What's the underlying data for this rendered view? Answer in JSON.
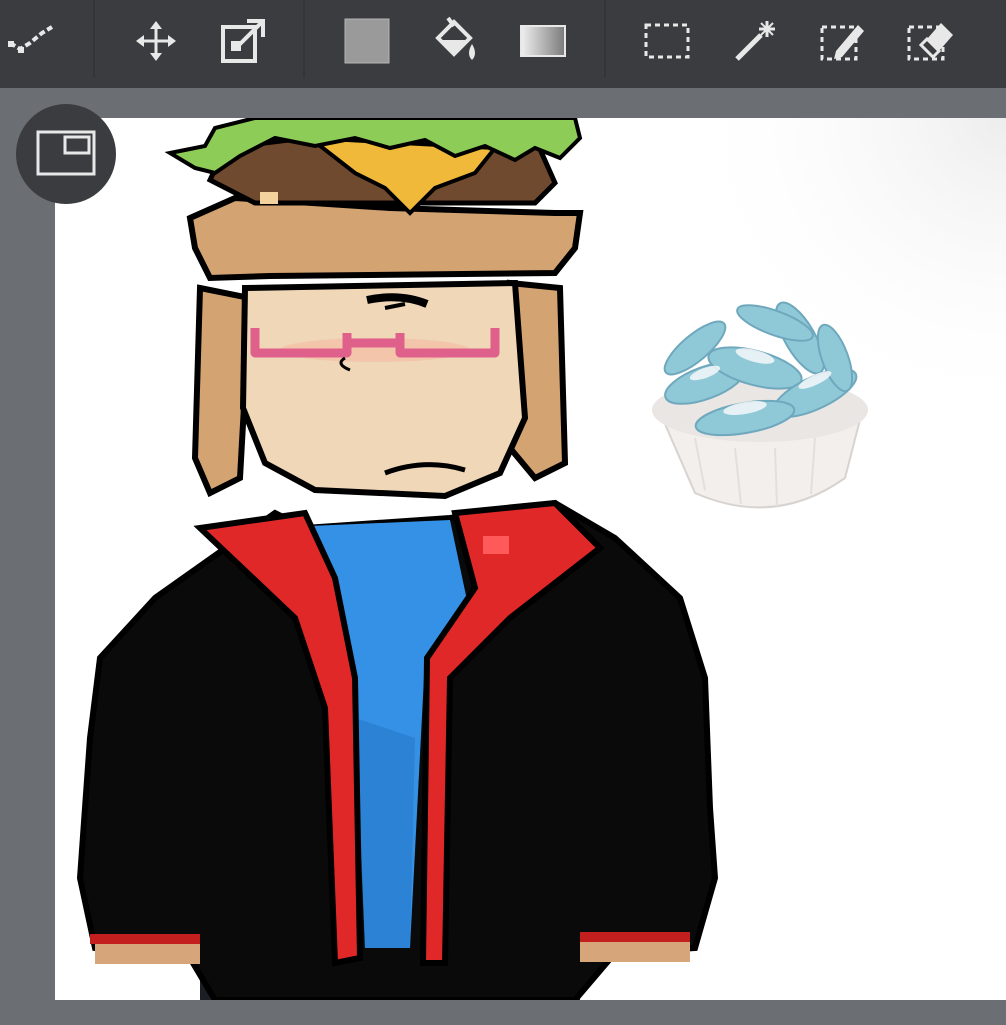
{
  "toolbar": {
    "tools": [
      {
        "icon": "polyline-tool-icon"
      },
      {
        "icon": "move-icon"
      },
      {
        "icon": "transform-icon"
      },
      {
        "icon": "fill-color-icon"
      },
      {
        "icon": "bucket-fill-icon"
      },
      {
        "icon": "gradient-icon"
      },
      {
        "icon": "rect-select-icon"
      },
      {
        "icon": "magic-wand-icon"
      },
      {
        "icon": "select-pen-icon"
      },
      {
        "icon": "select-eraser-icon"
      }
    ],
    "colors": {
      "background": "#3a3c40",
      "icon": "#e8e8e8",
      "swatch": "#9a9a9a"
    }
  },
  "canvas": {
    "background": "#ffffff",
    "workspace": "#6b6e73"
  },
  "frame_button": {
    "icon": "canvas-frame-icon"
  }
}
